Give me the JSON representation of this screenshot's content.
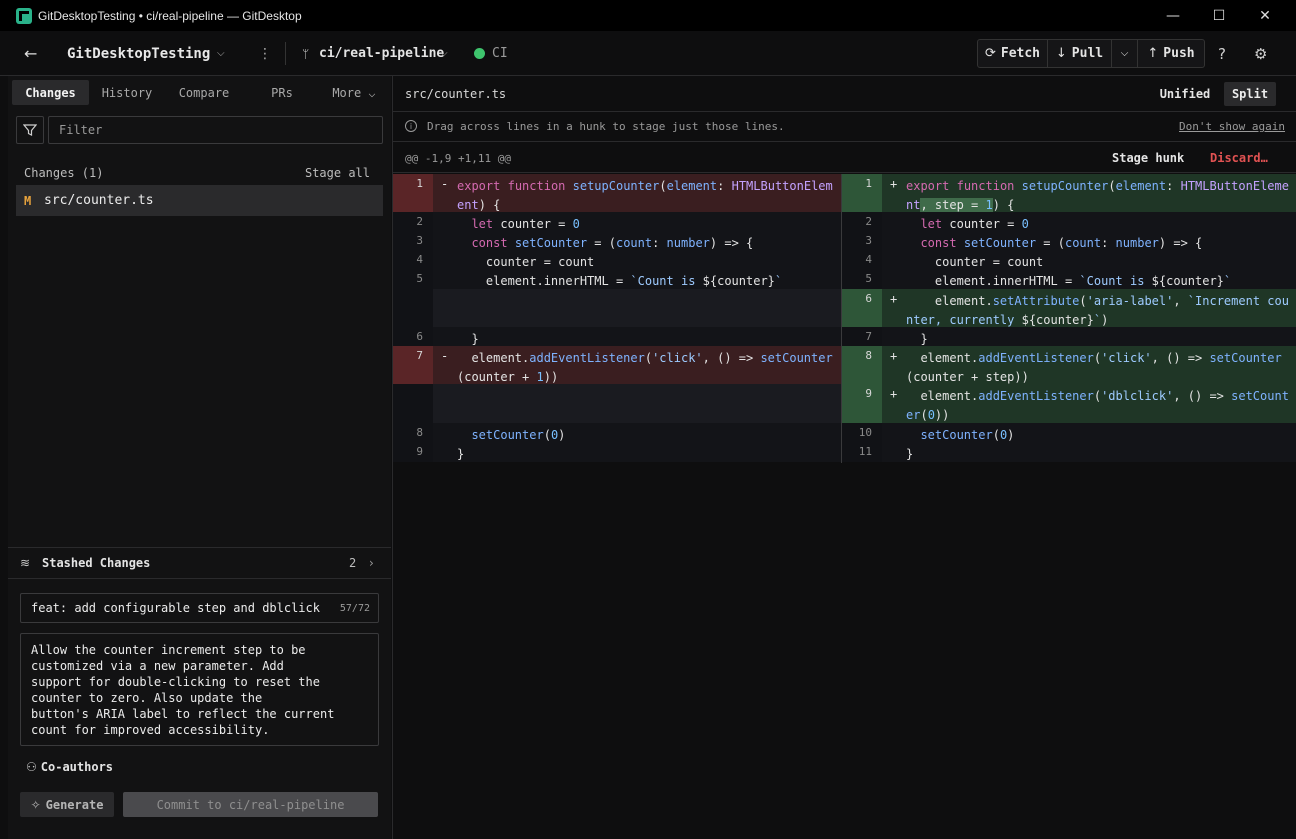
{
  "window": {
    "title": "GitDesktopTesting • ci/real-pipeline — GitDesktop",
    "minimize_glyph": "—",
    "maximize_glyph": "☐",
    "close_glyph": "✕"
  },
  "toolbar": {
    "back_glyph": "←",
    "repo_name": "GitDesktopTesting",
    "chevron": "⌵",
    "menu_glyph": "⋮",
    "branch_glyph": "ᛘ",
    "branch": "ci/real-pipeline",
    "ci_label": "CI",
    "fetch_label": "Fetch",
    "fetch_glyph": "⟳",
    "pull_label": "Pull",
    "pull_glyph": "↓",
    "push_label": "Push",
    "push_glyph": "↑",
    "more_glyph": "⌵",
    "help_glyph": "?",
    "settings_glyph": "⚙"
  },
  "tabs": [
    {
      "label": "Changes",
      "active": true
    },
    {
      "label": "History"
    },
    {
      "label": "Compare"
    },
    {
      "label": "PRs"
    },
    {
      "label": "More ⌵"
    }
  ],
  "filter": {
    "placeholder": "Filter"
  },
  "changes": {
    "header": "Changes (1)",
    "stage_all": "Stage all",
    "files": [
      {
        "status": "M",
        "path": "src/counter.ts"
      }
    ]
  },
  "stash": {
    "label": "Stashed Changes",
    "count": "2",
    "icon_glyph": "≋",
    "chevron": "›"
  },
  "commit": {
    "summary": "feat: add configurable step and dblclick r",
    "summary_count": "57/72",
    "description": "Allow the counter increment step to be\ncustomized via a new parameter. Add\nsupport for double-clicking to reset the\ncounter to zero. Also update the\nbutton's ARIA label to reflect the current\ncount for improved accessibility.",
    "coauthors_label": "Co-authors",
    "coauthors_glyph": "⚇",
    "generate_label": "Generate",
    "generate_glyph": "✧",
    "commit_label": "Commit to ci/real-pipeline"
  },
  "diff": {
    "filename": "src/counter.ts",
    "view_unified": "Unified",
    "view_split": "Split",
    "hint_icon": "i",
    "hint": "Drag across lines in a hunk to stage just those lines.",
    "dont_show": "Don't show again",
    "hunk_range": "@@ -1,9 +1,11 @@",
    "stage_hunk": "Stage hunk",
    "discard": "Discard…"
  },
  "colors": {
    "accent_ci": "#3ec46d",
    "deleted_row": "#3a1e20",
    "added_row": "#1f3626",
    "discard": "#e05252",
    "modified_status": "#e8a33d"
  }
}
